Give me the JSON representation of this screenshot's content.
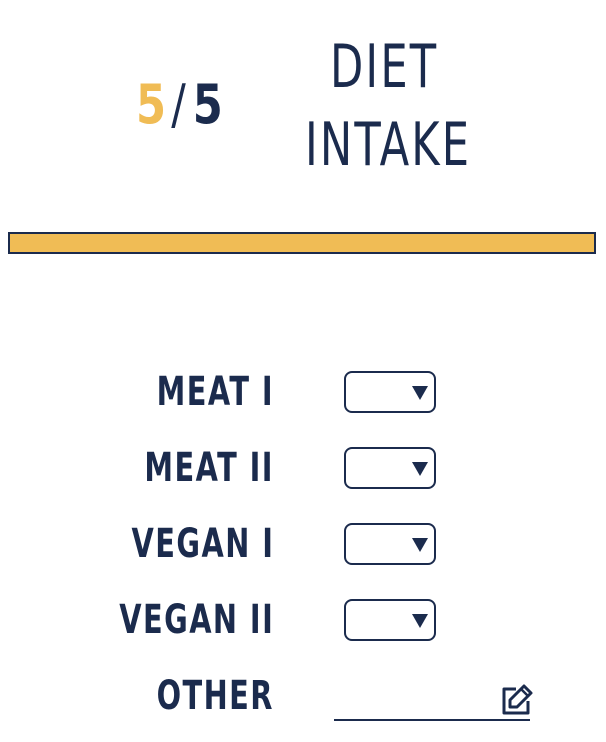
{
  "header": {
    "step_current": "5",
    "step_separator": "/",
    "step_total": "5",
    "title_line1": "DIET",
    "title_line2": "INTAKE"
  },
  "progress": {
    "fraction": 1.0
  },
  "form": {
    "fields": [
      {
        "label": "MEAT I",
        "value": ""
      },
      {
        "label": "MEAT II",
        "value": ""
      },
      {
        "label": "VEGAN I",
        "value": ""
      },
      {
        "label": "VEGAN II",
        "value": ""
      }
    ],
    "other": {
      "label": "OTHER",
      "value": ""
    }
  },
  "icons": {
    "select_arrow": "triangle-down-icon",
    "edit": "pencil-edit-icon"
  },
  "colors": {
    "navy": "#1b2b4d",
    "accent": "#f0bc55",
    "background": "#ffffff"
  }
}
